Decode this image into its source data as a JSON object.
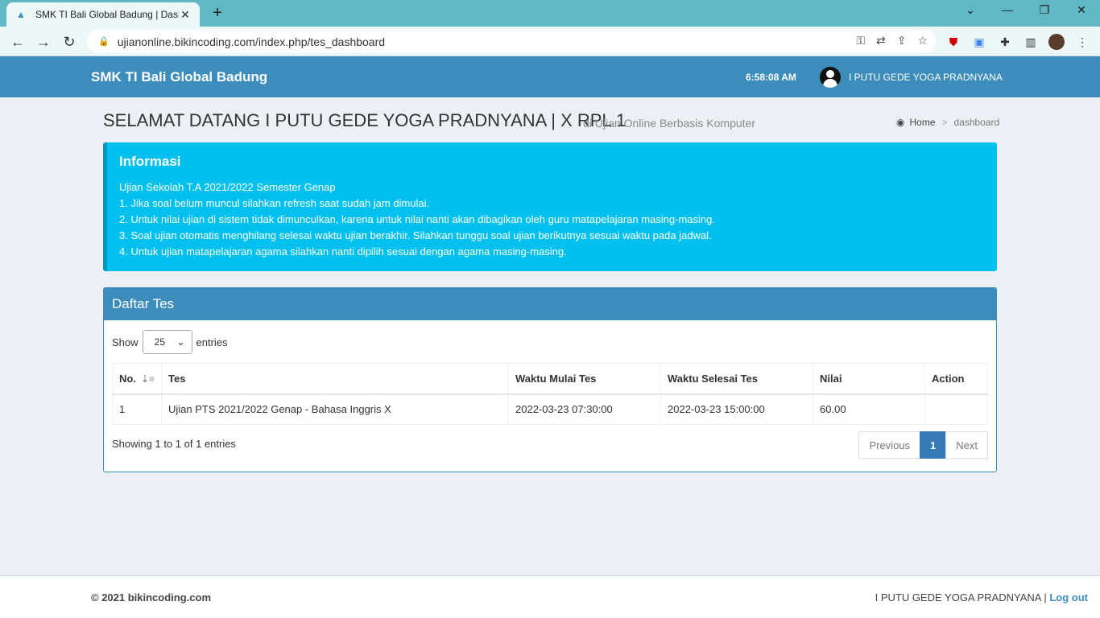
{
  "browser": {
    "tab_title": "SMK TI Bali Global Badung | Dash",
    "new_tab": "+",
    "close_tab": "✕",
    "url": "ujianonline.bikincoding.com/index.php/tes_dashboard",
    "window_controls": [
      "⌄",
      "—",
      "❐",
      "✕"
    ]
  },
  "header": {
    "brand": "SMK TI Bali Global Badung",
    "time": "6:58:08 AM",
    "user_name": "I PUTU GEDE YOGA PRADNYANA"
  },
  "page": {
    "title": "SELAMAT DATANG I PUTU GEDE YOGA PRADNYANA | X RPL 1",
    "subtitle": "di Ujian Online Berbasis Komputer",
    "breadcrumb_home": "Home",
    "breadcrumb_current": "dashboard"
  },
  "info": {
    "heading": "Informasi",
    "lines": [
      "Ujian Sekolah T.A 2021/2022 Semester Genap",
      "1. Jika soal belum muncul silahkan refresh saat sudah jam dimulai.",
      "2. Untuk nilai ujian di sistem tidak dimunculkan, karena untuk nilai nanti akan dibagikan oleh guru matapelajaran masing-masing.",
      "3. Soal ujian otomatis menghilang selesai waktu ujian berakhir. Silahkan tunggu soal ujian berikutnya sesuai waktu pada jadwal.",
      "4. Untuk ujian matapelajaran agama silahkan nanti dipilih sesuai dengan agama masing-masing."
    ]
  },
  "tests": {
    "heading": "Daftar Tes",
    "show_label": "Show",
    "entries_value": "25",
    "entries_label": "entries",
    "columns": [
      "No.",
      "Tes",
      "Waktu Mulai Tes",
      "Waktu Selesai Tes",
      "Nilai",
      "Action"
    ],
    "rows": [
      [
        "1",
        "Ujian PTS 2021/2022 Genap - Bahasa Inggris X",
        "2022-03-23 07:30:00",
        "2022-03-23 15:00:00",
        "60.00",
        ""
      ]
    ],
    "info_text": "Showing 1 to 1 of 1 entries",
    "pager": {
      "previous": "Previous",
      "page": "1",
      "next": "Next"
    }
  },
  "footer": {
    "copyright": "© 2021 bikincoding.com",
    "user": "I PUTU GEDE YOGA PRADNYANA |",
    "logout": "Log out"
  }
}
